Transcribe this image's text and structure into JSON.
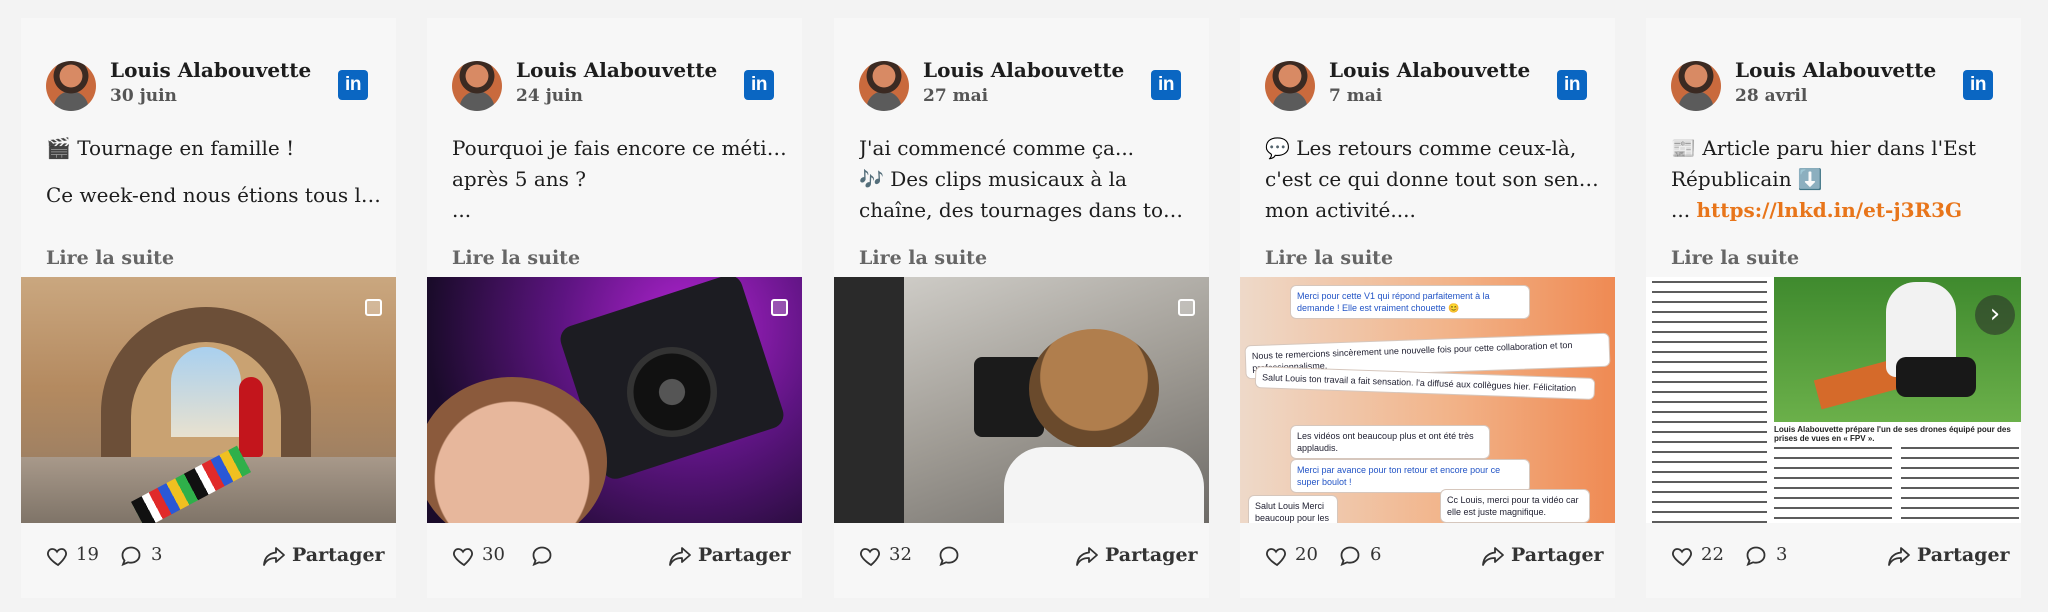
{
  "author": "Louis Alabouvette",
  "read_more": "Lire la suite",
  "share_label": "Partager",
  "colors": {
    "linkedin": "#0a66c2",
    "link": "#e8751a"
  },
  "posts": [
    {
      "date": "30 juin",
      "lines": [
        "🎬 Tournage en famille !",
        "",
        "Ce week-end nous étions tous les"
      ],
      "likes": "19",
      "comments": "3",
      "image": "archway-family-filming"
    },
    {
      "date": "24 juin",
      "lines": [
        "Pourquoi je fais encore ce métier",
        "après 5 ans ?",
        "..."
      ],
      "likes": "30",
      "comments": "",
      "image": "camera-purple-light"
    },
    {
      "date": "27 mai",
      "lines": [
        "J'ai commencé comme ça...",
        "🎶 Des clips musicaux à la",
        "chaîne, des tournages dans tou..."
      ],
      "likes": "32",
      "comments": "",
      "image": "kids-filming"
    },
    {
      "date": "7 mai",
      "lines": [
        "💬 Les retours comme ceux-là,",
        "c'est ce qui donne tout son sens à",
        "mon activité...."
      ],
      "likes": "20",
      "comments": "6",
      "image": "client-messages",
      "messages": [
        "Merci pour cette V1 qui répond parfaitement à la demande ! Elle est vraiment chouette 😊",
        "Nous te remercions sincèrement une nouvelle fois pour cette collaboration et ton professionnalisme.",
        "Salut Louis ton travail a fait sensation. l'a diffusé aux collègues hier. Félicitation",
        "Les vidéos ont beaucoup plus et ont été très applaudis.",
        "Merci par avance pour ton retour et encore pour ce super boulot !",
        "Salut Louis Merci beaucoup pour les vidéos",
        "Cc Louis, merci pour ta vidéo car elle est juste magnifique."
      ]
    },
    {
      "date": "28 avril",
      "lines": [
        "📰 Article paru hier dans l'Est",
        "Républicain ⬇️"
      ],
      "link_prefix": "... ",
      "link": "https://lnkd.in/et-j3R3G",
      "likes": "22",
      "comments": "3",
      "image": "newspaper-article",
      "caption": "Louis Alabouvette prépare l'un de ses drones équipé pour des prises de vues en « FPV »."
    }
  ]
}
